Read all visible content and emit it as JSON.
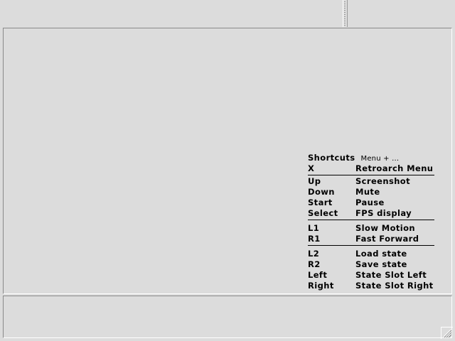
{
  "shortcuts": {
    "title": "Shortcuts",
    "subtitle": "Menu + ...",
    "groups": [
      [
        {
          "key": "X",
          "action": "Retroarch Menu"
        }
      ],
      [
        {
          "key": "Up",
          "action": "Screenshot"
        },
        {
          "key": "Down",
          "action": "Mute"
        },
        {
          "key": "Start",
          "action": "Pause"
        },
        {
          "key": "Select",
          "action": "FPS display"
        }
      ],
      [
        {
          "key": "L1",
          "action": "Slow Motion"
        },
        {
          "key": "R1",
          "action": "Fast Forward"
        }
      ],
      [
        {
          "key": "L2",
          "action": "Load state"
        },
        {
          "key": "R2",
          "action": "Save state"
        },
        {
          "key": "Left",
          "action": "State Slot Left"
        },
        {
          "key": "Right",
          "action": "State Slot Right"
        }
      ]
    ]
  }
}
